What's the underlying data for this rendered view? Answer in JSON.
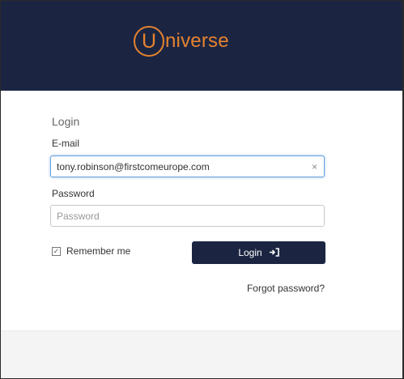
{
  "brand": {
    "logo_letter": "U",
    "logo_rest": "niverse",
    "colors": {
      "header_bg": "#1b2542",
      "logo": "#e5822f",
      "button_bg": "#1b2542"
    }
  },
  "form": {
    "title": "Login",
    "email_label": "E-mail",
    "email_value": "tony.robinson@firstcomeurope.com",
    "email_clear_icon": "×",
    "password_label": "Password",
    "password_placeholder": "Password",
    "remember_label": "Remember me",
    "remember_checked": true,
    "login_label": "Login",
    "login_icon": "sign-in-icon",
    "forgot_label": "Forgot password?"
  }
}
